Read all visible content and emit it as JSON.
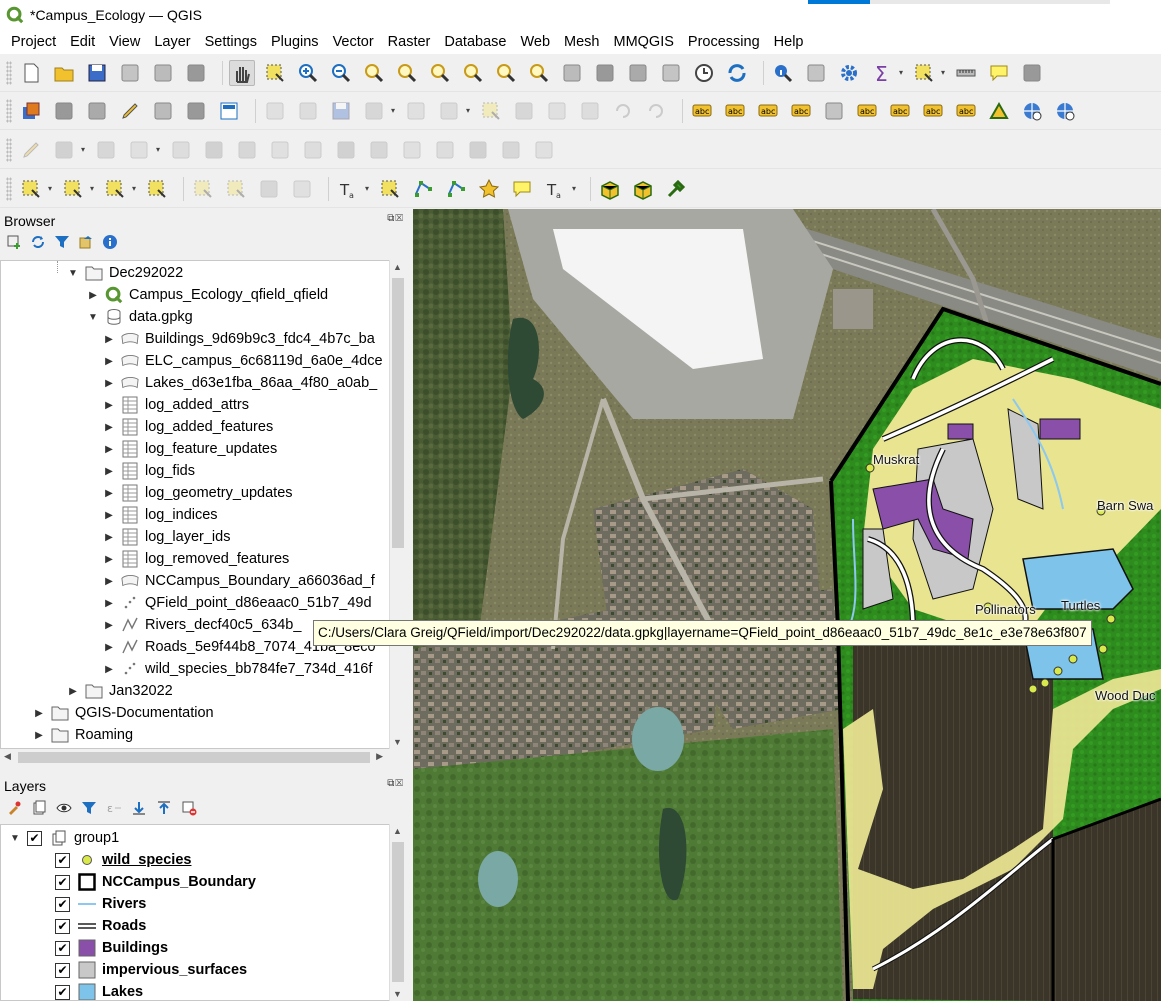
{
  "window": {
    "title": "*Campus_Ecology — QGIS"
  },
  "menubar": [
    "Project",
    "Edit",
    "View",
    "Layer",
    "Settings",
    "Plugins",
    "Vector",
    "Raster",
    "Database",
    "Web",
    "Mesh",
    "MMQGIS",
    "Processing",
    "Help"
  ],
  "toolbars": {
    "row1": [
      "new-project-icon",
      "open-project-icon",
      "save-project-icon",
      "project-properties-icon",
      "style-manager-icon",
      "layout-manager-icon",
      "pan-icon",
      "pan-to-selection-icon",
      "zoom-in-icon",
      "zoom-out-icon",
      "zoom-full-icon",
      "zoom-to-selection-icon",
      "zoom-to-layer-icon",
      "zoom-native-icon",
      "zoom-last-icon",
      "zoom-next-icon",
      "new-map-view-icon",
      "new-3d-view-icon",
      "new-bookmark-icon",
      "show-bookmarks-icon",
      "temporal-controller-icon",
      "refresh-icon",
      "identify-icon",
      "attribute-table-icon",
      "settings-gear-icon",
      "statistics-sum-icon",
      "select-table-icon",
      "measure-icon",
      "annotation-icon",
      "locator-icon"
    ],
    "row2": [
      "data-source-manager-icon",
      "new-geopackage-icon",
      "new-shapefile-icon",
      "digitize-icon",
      "temporary-layer-icon",
      "virtual-layer-icon",
      "field-calculator-icon",
      "current-edits-icon",
      "toggle-editing-icon",
      "save-edits-icon",
      "add-feature-icon",
      "vertex-tool-icon",
      "modify-attributes-icon",
      "delete-selected-icon",
      "cut-features-icon",
      "copy-features-icon",
      "paste-features-icon",
      "undo-icon",
      "redo-icon",
      "label-abc-icon",
      "label-color-icon",
      "pin-label-icon",
      "remove-label-icon",
      "highlight-pinned-icon",
      "show-hide-labels-icon",
      "move-label-icon",
      "rotate-label-icon",
      "change-label-icon",
      "add-vertex-icon",
      "globe-icon",
      "globe-search-icon"
    ],
    "row3": [
      "advanced-digitize-icon",
      "curve-icon",
      "add-ring-icon",
      "add-part-icon",
      "fill-ring-icon",
      "delete-ring-icon",
      "delete-part-icon",
      "reshape-icon",
      "offset-curve-icon",
      "split-features-icon",
      "split-parts-icon",
      "merge-features-icon",
      "merge-attributes-icon",
      "rotate-point-icon",
      "simplify-icon",
      "trim-extend-icon"
    ],
    "row4": [
      "select-features-icon",
      "select-by-value-icon",
      "deselect-icon",
      "select-by-location-icon",
      "vector-select-icon",
      "raster-select-icon",
      "buffer-icon",
      "clip-icon",
      "add-text-icon",
      "cursor-select-icon",
      "node-tool-icon",
      "edge-tool-icon",
      "star-icon",
      "text-annotation-icon",
      "text-tool-icon",
      "box-icon",
      "box-tool-icon",
      "hammer-tool-icon"
    ]
  },
  "browser": {
    "title": "Browser",
    "items": [
      {
        "label": "Dec292022",
        "icon": "folder-icon",
        "level": 2,
        "expanded": true
      },
      {
        "label": "Campus_Ecology_qfield_qfield",
        "icon": "qgis-project-icon",
        "level": 3,
        "expanded": false
      },
      {
        "label": "data.gpkg",
        "icon": "database-icon",
        "level": 3,
        "expanded": true
      },
      {
        "label": "Buildings_9d69b9c3_fdc4_4b7c_ba",
        "icon": "polygon-layer-icon",
        "level": 4
      },
      {
        "label": "ELC_campus_6c68119d_6a0e_4dce",
        "icon": "polygon-layer-icon",
        "level": 4
      },
      {
        "label": "Lakes_d63e1fba_86aa_4f80_a0ab_",
        "icon": "polygon-layer-icon",
        "level": 4
      },
      {
        "label": "log_added_attrs",
        "icon": "table-icon",
        "level": 4
      },
      {
        "label": "log_added_features",
        "icon": "table-icon",
        "level": 4
      },
      {
        "label": "log_feature_updates",
        "icon": "table-icon",
        "level": 4
      },
      {
        "label": "log_fids",
        "icon": "table-icon",
        "level": 4
      },
      {
        "label": "log_geometry_updates",
        "icon": "table-icon",
        "level": 4
      },
      {
        "label": "log_indices",
        "icon": "table-icon",
        "level": 4
      },
      {
        "label": "log_layer_ids",
        "icon": "table-icon",
        "level": 4
      },
      {
        "label": "log_removed_features",
        "icon": "table-icon",
        "level": 4
      },
      {
        "label": "NCCampus_Boundary_a66036ad_f",
        "icon": "polygon-layer-icon",
        "level": 4
      },
      {
        "label": "QField_point_d86eaac0_51b7_49d",
        "icon": "point-layer-icon",
        "level": 4
      },
      {
        "label": "Rivers_decf40c5_634b_",
        "icon": "line-layer-icon",
        "level": 4
      },
      {
        "label": "Roads_5e9f44b8_7074_41ba_8ec0",
        "icon": "line-layer-icon",
        "level": 4
      },
      {
        "label": "wild_species_bb784fe7_734d_416f",
        "icon": "point-layer-icon",
        "level": 4
      },
      {
        "label": "Jan32022",
        "icon": "folder-icon",
        "level": 2,
        "expanded": false
      },
      {
        "label": "QGIS-Documentation",
        "icon": "folder-icon",
        "level": 1,
        "expanded": false
      },
      {
        "label": "Roaming",
        "icon": "folder-icon",
        "level": 1,
        "expanded": false
      }
    ]
  },
  "tooltip": "C:/Users/Clara Greig/QField/import/Dec292022/data.gpkg|layername=QField_point_d86eaac0_51b7_49dc_8e1c_e3e78e63f807",
  "layers": {
    "title": "Layers",
    "group": "group1",
    "items": [
      {
        "label": "wild_species",
        "symbol": "point",
        "color": "#d9e84a",
        "underline": true
      },
      {
        "label": "NCCampus_Boundary",
        "symbol": "outline",
        "color": "#000000"
      },
      {
        "label": "Rivers",
        "symbol": "line",
        "color": "#8cc8f0"
      },
      {
        "label": "Roads",
        "symbol": "double-line",
        "color": "#222222"
      },
      {
        "label": "Buildings",
        "symbol": "fill",
        "color": "#8a4fa8"
      },
      {
        "label": "impervious_surfaces",
        "symbol": "fill",
        "color": "#c8c8c8"
      },
      {
        "label": "Lakes",
        "symbol": "fill",
        "color": "#7ec4ea"
      }
    ]
  },
  "map": {
    "labels": [
      "Muskrat",
      "Barn Swa",
      "Pollinators",
      "Turtles",
      "Wood Duc"
    ],
    "colors": {
      "forest": "#2e8b1e",
      "meadow": "#e8e490",
      "building": "#8a4fa8",
      "impervious": "#c8c8c8",
      "lake": "#7ec4ea",
      "boundary": "#000000"
    }
  }
}
